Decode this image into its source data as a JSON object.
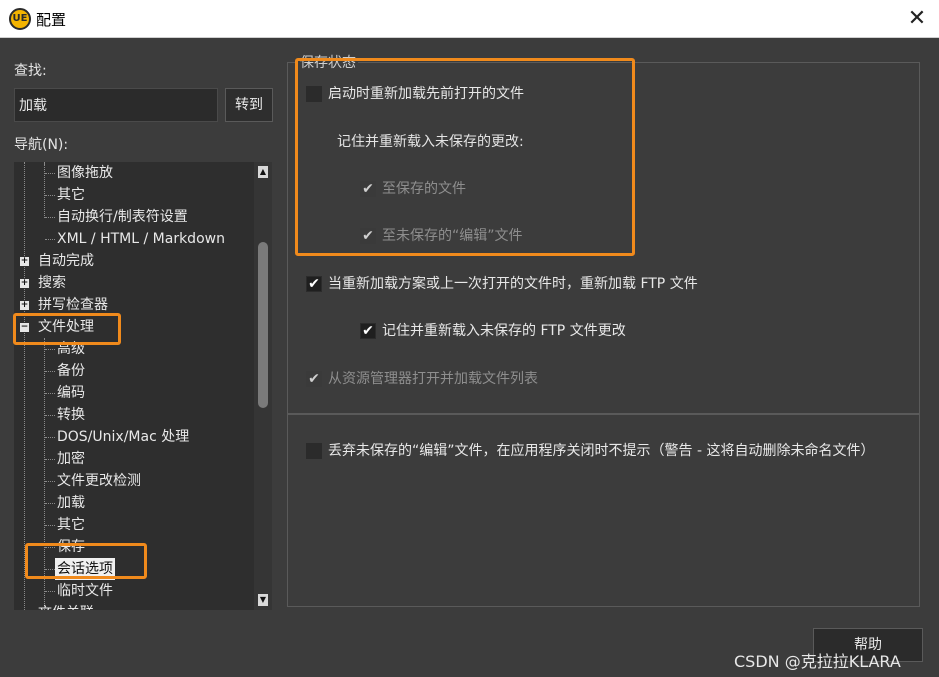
{
  "window": {
    "title": "配置",
    "app_icon_text": "UE",
    "close_glyph": "✕"
  },
  "search": {
    "label": "查找:",
    "value": "加载",
    "goto_label": "转到"
  },
  "nav": {
    "label": "导航(N):",
    "items": [
      {
        "label": "图像拖放"
      },
      {
        "label": "其它"
      },
      {
        "label": "自动换行/制表符设置"
      },
      {
        "label": "XML / HTML / Markdown"
      },
      {
        "label": "自动完成"
      },
      {
        "label": "搜索"
      },
      {
        "label": "拼写检查器"
      },
      {
        "label": "文件处理"
      },
      {
        "label": "高级"
      },
      {
        "label": "备份"
      },
      {
        "label": "编码"
      },
      {
        "label": "转换"
      },
      {
        "label": "DOS/Unix/Mac 处理"
      },
      {
        "label": "加密"
      },
      {
        "label": "文件更改检测"
      },
      {
        "label": "加载"
      },
      {
        "label": "其它"
      },
      {
        "label": "保存"
      },
      {
        "label": "会话选项"
      },
      {
        "label": "临时文件"
      },
      {
        "label": "文件关联"
      }
    ],
    "expander_plus": "+",
    "expander_minus": "−",
    "selected_item": "会话选项"
  },
  "panel": {
    "group_title": "保存状态",
    "opt_reload_open_files": {
      "label": "启动时重新加载先前打开的文件",
      "checked": false
    },
    "remember_unsaved_label": "记住并重新载入未保存的更改:",
    "opt_to_saved_files": {
      "label": "至保存的文件",
      "checked": true
    },
    "opt_to_unsaved_edits": {
      "label": "至未保存的“编辑”文件",
      "checked": true
    },
    "opt_reload_ftp": {
      "label": "当重新加载方案或上一次打开的文件时，重新加载 FTP 文件",
      "checked": true
    },
    "opt_remember_ftp": {
      "label": "记住并重新载入未保存的 FTP 文件更改",
      "checked": true
    },
    "opt_explorer_list": {
      "label": "从资源管理器打开并加载文件列表",
      "checked": true
    },
    "opt_discard_unsaved": {
      "label": "丢弃未保存的“编辑”文件，在应用程序关闭时不提示（警告 - 这将自动删除未命名文件）",
      "checked": false
    }
  },
  "footer": {
    "help_label": "帮助",
    "watermark": "CSDN @克拉拉KLARA"
  },
  "colors": {
    "highlight": "#f08a1c",
    "background": "#3c3c3c"
  },
  "icons": {
    "check": "✔",
    "scroll_up": "▲",
    "scroll_down": "▼"
  }
}
